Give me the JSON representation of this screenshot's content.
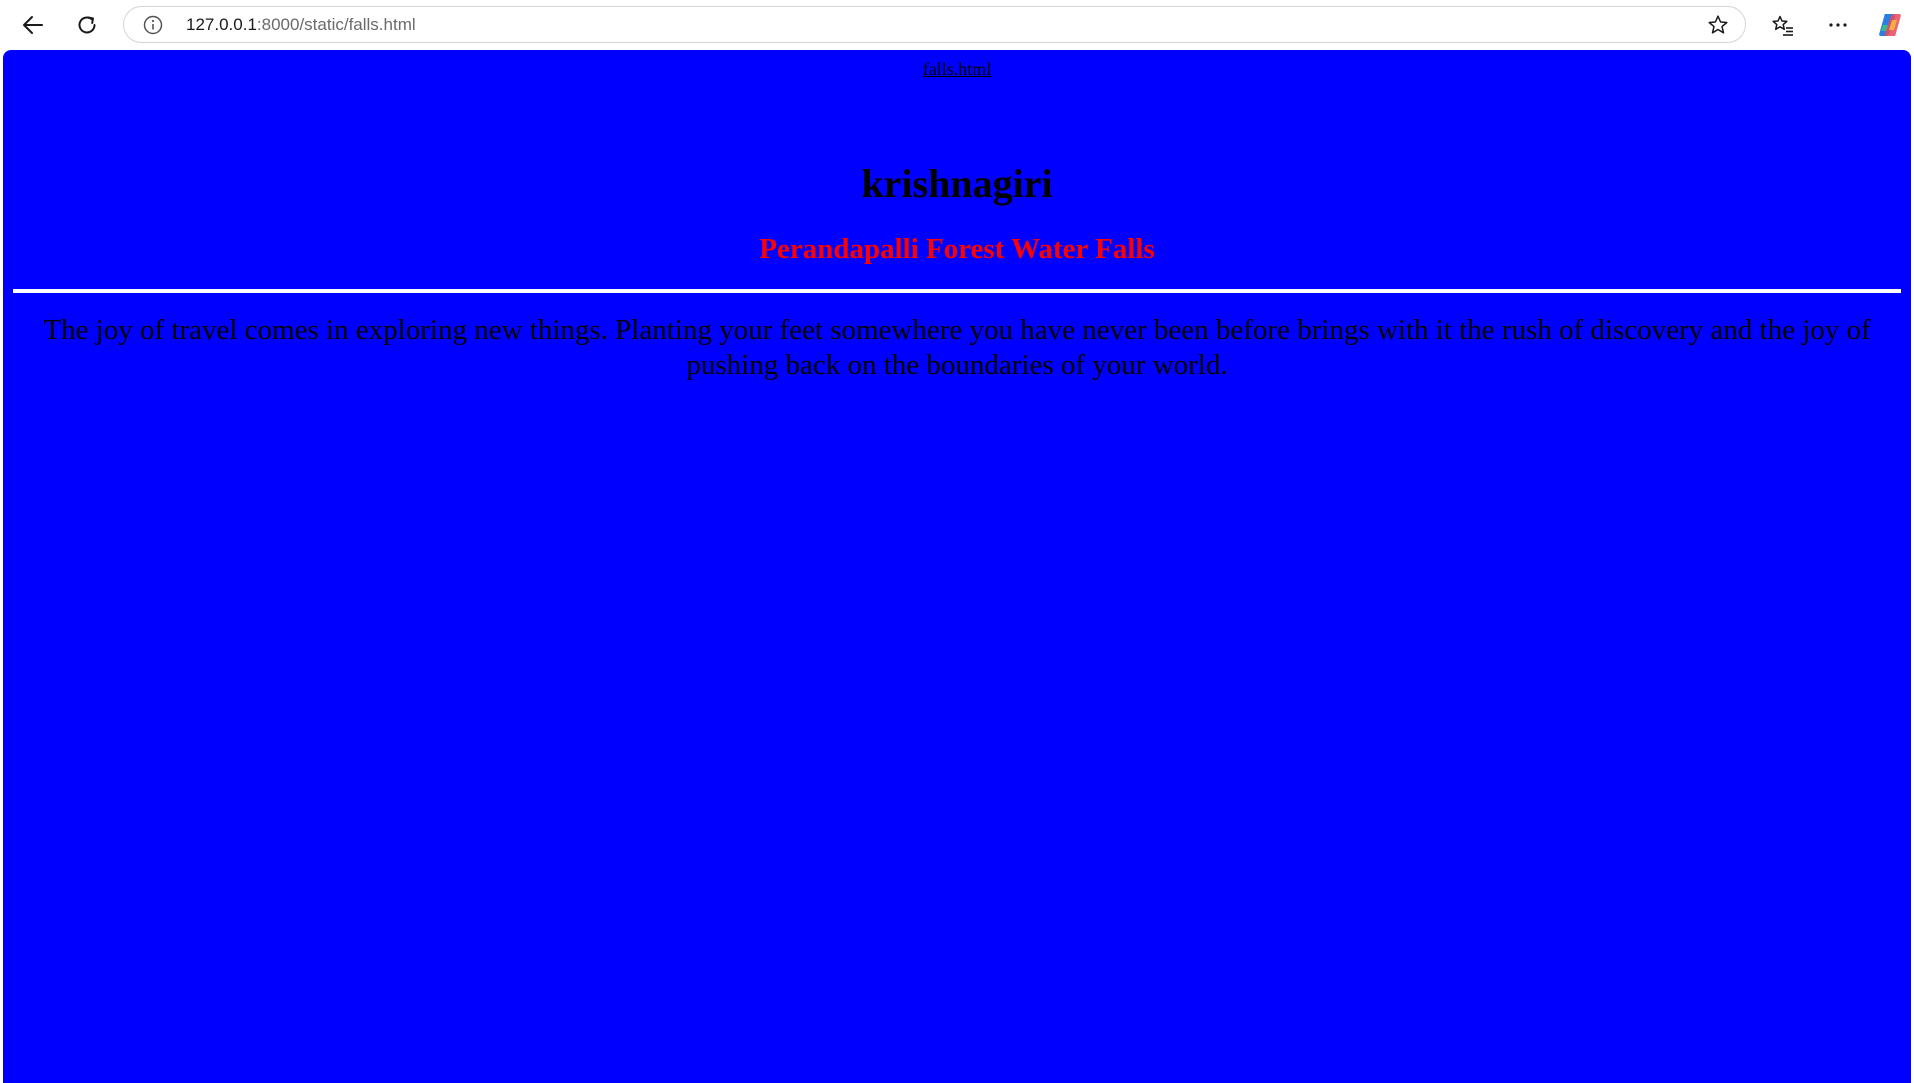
{
  "browser": {
    "url_host": "127.0.0.1",
    "url_rest": ":8000/static/falls.html",
    "icons": {
      "back": "back-arrow-icon",
      "reload": "reload-icon",
      "info": "info-icon",
      "favorite": "star-icon",
      "favorites_list": "favorites-list-icon",
      "menu": "more-horizontal-icon",
      "copilot": "copilot-icon"
    }
  },
  "page": {
    "filename": "falls.html",
    "heading": "krishnagiri",
    "subheading": "Perandapalli Forest Water Falls",
    "paragraph": "The joy of travel comes in exploring new things. Planting your feet somewhere you have never been before brings with it the rush of discovery and the joy of pushing back on the boundaries of your world."
  },
  "colors": {
    "page_background": "#0000ff",
    "subheading": "#ff0000",
    "rule": "#ffffff",
    "text": "#000000"
  }
}
